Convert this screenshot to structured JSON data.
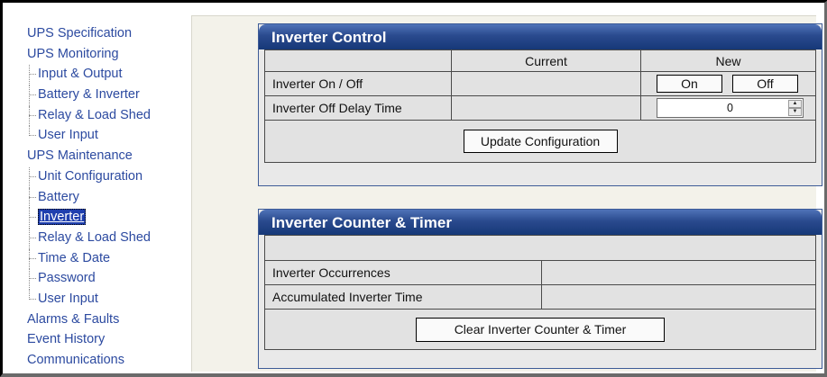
{
  "nav": {
    "items": [
      {
        "label": "UPS Specification",
        "level": 0,
        "selected": false
      },
      {
        "label": "UPS Monitoring",
        "level": 0,
        "selected": false
      },
      {
        "label": "Input & Output",
        "level": 1,
        "selected": false
      },
      {
        "label": "Battery & Inverter",
        "level": 1,
        "selected": false
      },
      {
        "label": "Relay & Load Shed",
        "level": 1,
        "selected": false
      },
      {
        "label": "User Input",
        "level": 1,
        "selected": false
      },
      {
        "label": "UPS Maintenance",
        "level": 0,
        "selected": false
      },
      {
        "label": "Unit Configuration",
        "level": 1,
        "selected": false
      },
      {
        "label": "Battery",
        "level": 1,
        "selected": false
      },
      {
        "label": "Inverter",
        "level": 1,
        "selected": true
      },
      {
        "label": "Relay & Load Shed",
        "level": 1,
        "selected": false
      },
      {
        "label": "Time & Date",
        "level": 1,
        "selected": false
      },
      {
        "label": "Password",
        "level": 1,
        "selected": false
      },
      {
        "label": "User Input",
        "level": 1,
        "selected": false
      },
      {
        "label": "Alarms & Faults",
        "level": 0,
        "selected": false
      },
      {
        "label": "Event History",
        "level": 0,
        "selected": false
      },
      {
        "label": "Communications",
        "level": 0,
        "selected": false
      }
    ]
  },
  "inverter_control": {
    "title": "Inverter Control",
    "col_current": "Current",
    "col_new": "New",
    "rows": {
      "on_off": {
        "label": "Inverter On / Off",
        "current": "",
        "on_label": "On",
        "off_label": "Off"
      },
      "delay": {
        "label": "Inverter Off Delay Time",
        "current": "",
        "value": "0"
      }
    },
    "update_button": "Update Configuration"
  },
  "counter_timer": {
    "title": "Inverter Counter & Timer",
    "rows": [
      {
        "label": "Inverter Occurrences",
        "value": ""
      },
      {
        "label": "Accumulated Inverter Time",
        "value": ""
      }
    ],
    "clear_button": "Clear Inverter Counter & Timer"
  }
}
